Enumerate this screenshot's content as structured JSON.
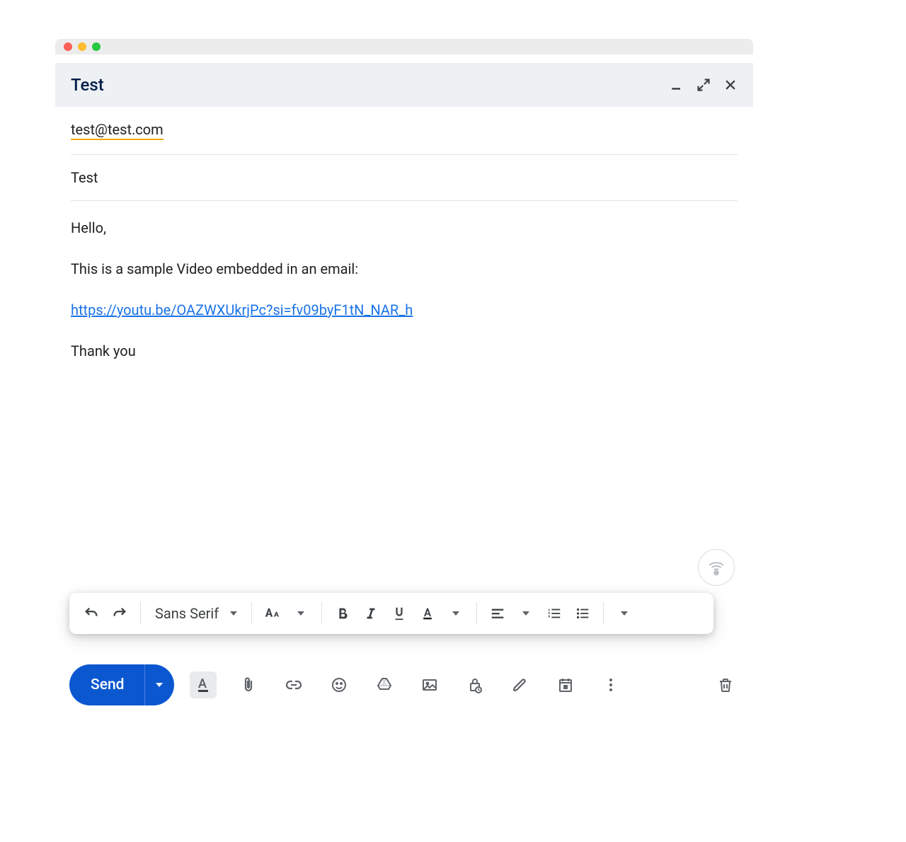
{
  "header": {
    "title": "Test"
  },
  "compose": {
    "to": "test@test.com",
    "subject": "Test",
    "body_line1": "Hello,",
    "body_line2": "This is a sample Video embedded in an email:",
    "body_link": "https://youtu.be/OAZWXUkrjPc?si=fv09byF1tN_NAR_h",
    "body_line3": "Thank you"
  },
  "format_toolbar": {
    "font": "Sans Serif"
  },
  "bottom_bar": {
    "send_label": "Send"
  },
  "colors": {
    "primary": "#0b57d0",
    "link": "#1a73e8",
    "header_text": "#041e49"
  }
}
